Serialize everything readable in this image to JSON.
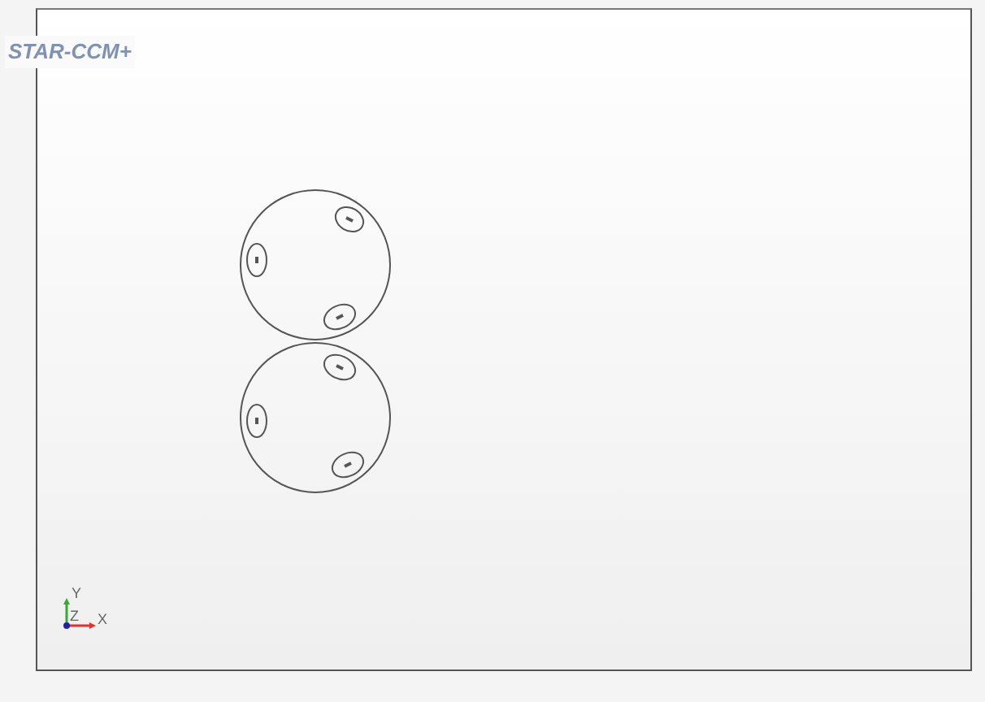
{
  "viewport": {
    "logo": "STAR-CCM+",
    "axes": {
      "y_label": "Y",
      "z_label": "Z",
      "x_label": "X"
    }
  }
}
